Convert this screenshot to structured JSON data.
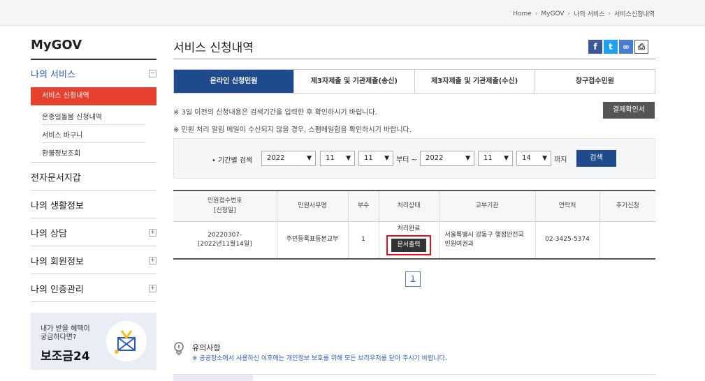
{
  "breadcrumb": [
    "Home",
    "MyGOV",
    "나의 서비스",
    "서비스신청내역"
  ],
  "sidebar": {
    "title": "MyGOV",
    "groups": [
      {
        "label": "나의 서비스",
        "toggle": "−"
      },
      {
        "label": "전자문서지갑"
      },
      {
        "label": "나의 생활정보"
      },
      {
        "label": "나의 상담",
        "toggle": "+"
      },
      {
        "label": "나의 회원정보",
        "toggle": "+"
      },
      {
        "label": "나의 인증관리",
        "toggle": "+"
      }
    ],
    "sub_items": [
      "서비스 신청내역",
      "온종일돌봄 신청내역",
      "서비스 바구니",
      "환불정보조회"
    ],
    "banner": {
      "line1": "내가 받을 혜택이",
      "line2": "궁금하다면?",
      "title": "보조금24"
    }
  },
  "page_title": "서비스 신청내역",
  "tabs": [
    "온라인 신청민원",
    "제3자제출 및 기관제출(송신)",
    "제3자제출 및 기관제출(수신)",
    "창구접수민원"
  ],
  "notices": [
    "※ 3일 이전의 신청내용은 검색기간을 입력한 후 확인하시기 바랍니다.",
    "※ 민원 처리 알림 메일이 수신되지 않을 경우, 스팸메일함을 확인하시기 바랍니다."
  ],
  "receipt_button": "결제확인서",
  "search": {
    "label": "• 기간별 검색",
    "from_year": "2022",
    "from_month": "11",
    "from_day": "11",
    "to_year": "2022",
    "to_month": "11",
    "to_day": "14",
    "from_suffix": "부터 ~",
    "to_suffix": "까지",
    "button": "검색"
  },
  "table": {
    "headers": [
      "민원접수번호\n[신청일]",
      "민원사무명",
      "부수",
      "처리상태",
      "교부기관",
      "연락처",
      "추가신청"
    ],
    "row": {
      "receipt_no": "20220307-",
      "date": "[2022년11월14일]",
      "name": "주민등록표등본교부",
      "count": "1",
      "status": "처리완료",
      "print_button": "문서출력",
      "agency_line1": "서울특별시 강동구 행정안전국",
      "agency_line2": "민원여권과",
      "phone": "02-3425-5374",
      "extra": ""
    }
  },
  "pager": "1",
  "caution": {
    "title": "유의사항",
    "text": "※ 공공장소에서 사용하신 이후에는 개인정보 보호를 위해 모든 브라우저를 닫아 주시기 바랍니다."
  },
  "share_icons": [
    "facebook-icon",
    "twitter-icon",
    "link-icon",
    "print-icon"
  ],
  "colors": {
    "accent": "#1f4a8c",
    "active_menu": "#e8402f",
    "highlight": "#e3101c"
  }
}
